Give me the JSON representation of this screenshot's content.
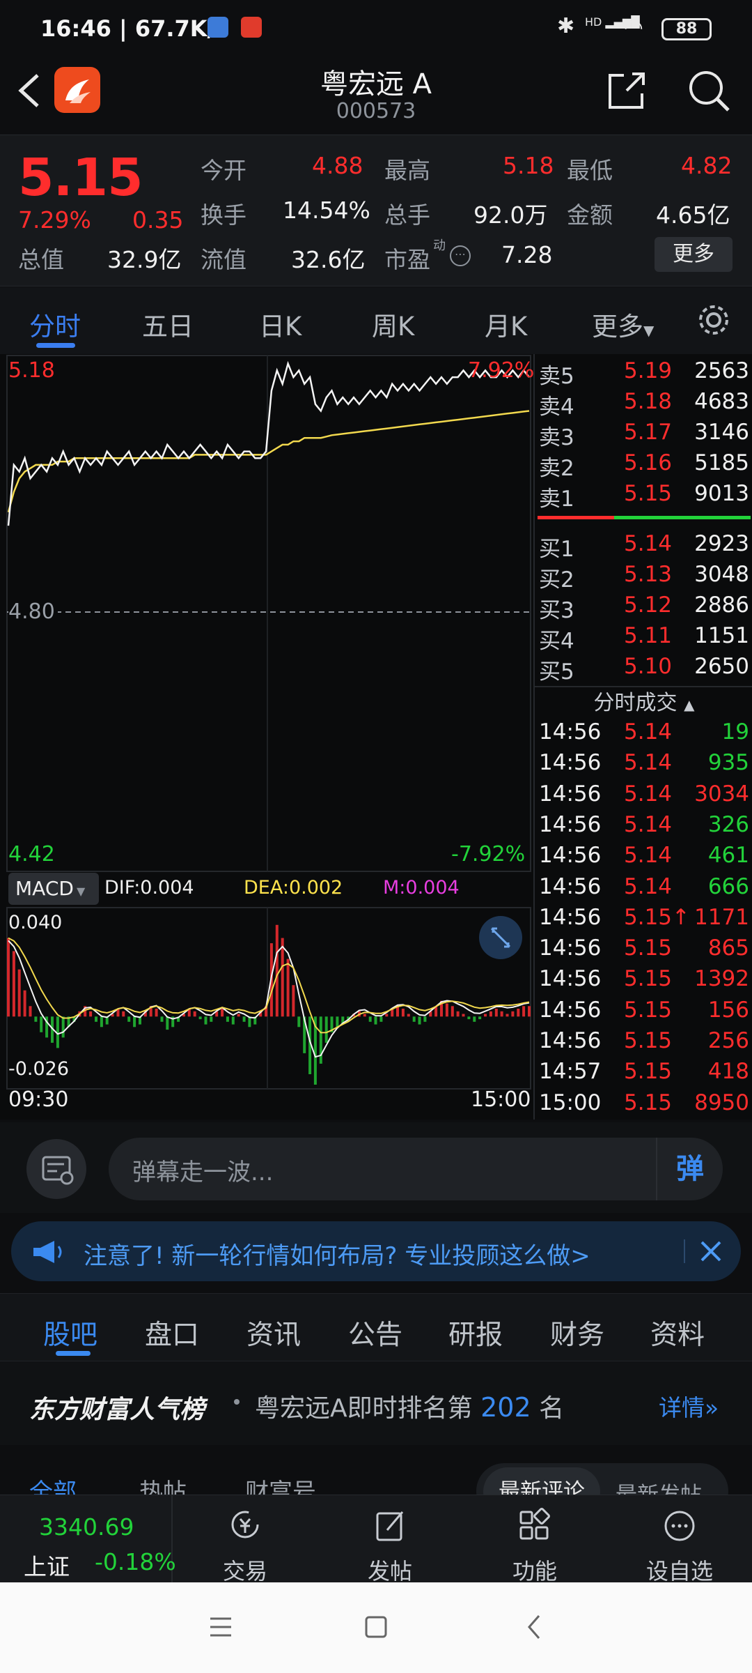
{
  "status_bar": {
    "time_speed": "16:46 | 67.7K/s",
    "network": "HD",
    "battery": "88"
  },
  "header": {
    "name": "粤宏远 A",
    "code": "000573"
  },
  "quote": {
    "price": "5.15",
    "change_pct": "7.29%",
    "change": "0.35",
    "stats": [
      {
        "label": "今开",
        "value": "4.88",
        "color": "red"
      },
      {
        "label": "最高",
        "value": "5.18",
        "color": "red"
      },
      {
        "label": "最低",
        "value": "4.82",
        "color": "red"
      },
      {
        "label": "换手",
        "value": "14.54%",
        "color": "white"
      },
      {
        "label": "总手",
        "value": "92.0万",
        "color": "white"
      },
      {
        "label": "金额",
        "value": "4.65亿",
        "color": "white"
      },
      {
        "label": "总值",
        "value": "32.9亿",
        "color": "white"
      },
      {
        "label": "流值",
        "value": "32.6亿",
        "color": "white"
      },
      {
        "label": "市盈",
        "value": "7.28",
        "color": "white"
      }
    ],
    "pe_sup": "动",
    "more_button": "更多"
  },
  "chart_tabs": [
    "分时",
    "五日",
    "日K",
    "周K",
    "月K",
    "更多"
  ],
  "chart_tabs_active": 0,
  "chart_data": {
    "type": "line",
    "price_axis": {
      "top": "5.18",
      "mid": "4.80",
      "bottom": "4.42",
      "top_pct": "7.92%",
      "bottom_pct": "-7.92%",
      "ylim": [
        4.42,
        5.18
      ]
    },
    "time_axis": {
      "start": "09:30",
      "end": "15:00"
    },
    "macd": {
      "label": "MACD",
      "dif": "DIF:0.004",
      "dea": "DEA:0.002",
      "m": "M:0.004",
      "top": "0.040",
      "bottom": "-0.026"
    },
    "price_series": [
      4.93,
      5.02,
      5.01,
      5.03,
      5.0,
      5.01,
      5.02,
      5.01,
      5.03,
      5.02,
      5.04,
      5.02,
      5.03,
      5.01,
      5.03,
      5.02,
      5.03,
      5.02,
      5.04,
      5.03,
      5.02,
      5.03,
      5.04,
      5.02,
      5.03,
      5.04,
      5.03,
      5.04,
      5.03,
      5.05,
      5.04,
      5.03,
      5.04,
      5.03,
      5.04,
      5.05,
      5.04,
      5.03,
      5.04,
      5.03,
      5.05,
      5.04,
      5.03,
      5.04,
      5.04,
      5.03,
      5.03,
      5.04,
      5.13,
      5.16,
      5.14,
      5.17,
      5.15,
      5.16,
      5.14,
      5.15,
      5.11,
      5.1,
      5.12,
      5.13,
      5.11,
      5.12,
      5.11,
      5.12,
      5.11,
      5.12,
      5.13,
      5.12,
      5.13,
      5.12,
      5.14,
      5.13,
      5.14,
      5.13,
      5.14,
      5.13,
      5.14,
      5.15,
      5.14,
      5.15,
      5.14,
      5.15,
      5.15,
      5.16,
      5.15,
      5.16,
      5.15,
      5.16,
      5.15,
      5.15,
      5.16,
      5.15,
      5.16,
      5.15,
      5.16,
      5.15
    ],
    "avg_series": [
      4.95,
      4.98,
      5.0,
      5.01,
      5.015,
      5.02,
      5.02,
      5.02,
      5.02,
      5.025,
      5.025,
      5.025,
      5.03,
      5.03,
      5.03,
      5.03,
      5.03,
      5.03,
      5.03,
      5.03,
      5.03,
      5.03,
      5.03,
      5.03,
      5.03,
      5.03,
      5.03,
      5.03,
      5.03,
      5.03,
      5.03,
      5.03,
      5.03,
      5.03,
      5.035,
      5.035,
      5.035,
      5.035,
      5.035,
      5.035,
      5.035,
      5.035,
      5.035,
      5.035,
      5.035,
      5.035,
      5.035,
      5.035,
      5.04,
      5.045,
      5.05,
      5.05,
      5.055,
      5.055,
      5.06,
      5.06,
      5.06,
      5.06,
      5.062,
      5.064,
      5.065,
      5.066,
      5.067,
      5.068,
      5.069,
      5.07,
      5.071,
      5.072,
      5.073,
      5.074,
      5.075,
      5.076,
      5.077,
      5.078,
      5.079,
      5.08,
      5.081,
      5.082,
      5.083,
      5.084,
      5.085,
      5.086,
      5.087,
      5.088,
      5.089,
      5.09,
      5.091,
      5.092,
      5.093,
      5.094,
      5.095,
      5.096,
      5.097,
      5.098,
      5.099,
      5.1
    ],
    "macd_bars": [
      0.03,
      0.025,
      0.018,
      0.01,
      0.004,
      -0.002,
      -0.006,
      -0.008,
      -0.01,
      -0.012,
      -0.008,
      -0.004,
      -0.002,
      0.002,
      0.004,
      0.002,
      -0.002,
      -0.004,
      -0.003,
      0.001,
      0.003,
      0.002,
      -0.002,
      -0.004,
      -0.003,
      0.002,
      0.004,
      0.003,
      -0.002,
      -0.005,
      -0.004,
      -0.002,
      0.001,
      0.003,
      0.002,
      -0.001,
      -0.003,
      -0.002,
      0.002,
      0.003,
      -0.002,
      -0.003,
      0.001,
      -0.002,
      -0.004,
      -0.003,
      0.002,
      0.004,
      0.028,
      0.035,
      0.03,
      0.022,
      0.012,
      -0.004,
      -0.014,
      -0.022,
      -0.026,
      -0.018,
      -0.01,
      -0.006,
      -0.004,
      -0.003,
      -0.002,
      0.001,
      0.002,
      0.001,
      -0.002,
      -0.003,
      -0.002,
      0.001,
      0.003,
      0.004,
      0.003,
      0.001,
      -0.002,
      -0.003,
      -0.002,
      0.002,
      0.004,
      0.006,
      0.005,
      0.004,
      0.002,
      0.001,
      -0.001,
      -0.002,
      -0.001,
      0.001,
      0.002,
      0.003,
      0.002,
      0.001,
      0.002,
      0.003,
      0.004,
      0.004
    ]
  },
  "order_book": {
    "sell": [
      {
        "label": "卖5",
        "price": "5.19",
        "vol": "2563"
      },
      {
        "label": "卖4",
        "price": "5.18",
        "vol": "4683"
      },
      {
        "label": "卖3",
        "price": "5.17",
        "vol": "3146"
      },
      {
        "label": "卖2",
        "price": "5.16",
        "vol": "5185"
      },
      {
        "label": "卖1",
        "price": "5.15",
        "vol": "9013"
      }
    ],
    "buy": [
      {
        "label": "买1",
        "price": "5.14",
        "vol": "2923"
      },
      {
        "label": "买2",
        "price": "5.13",
        "vol": "3048"
      },
      {
        "label": "买3",
        "price": "5.12",
        "vol": "2886"
      },
      {
        "label": "买4",
        "price": "5.11",
        "vol": "1151"
      },
      {
        "label": "买5",
        "price": "5.10",
        "vol": "2650"
      }
    ]
  },
  "ticks": {
    "header": "分时成交",
    "rows": [
      {
        "t": "14:56",
        "p": "5.14",
        "v": "19",
        "vc": "green"
      },
      {
        "t": "14:56",
        "p": "5.14",
        "v": "935",
        "vc": "green"
      },
      {
        "t": "14:56",
        "p": "5.14",
        "v": "3034",
        "vc": "red"
      },
      {
        "t": "14:56",
        "p": "5.14",
        "v": "326",
        "vc": "green"
      },
      {
        "t": "14:56",
        "p": "5.14",
        "v": "461",
        "vc": "green"
      },
      {
        "t": "14:56",
        "p": "5.14",
        "v": "666",
        "vc": "green"
      },
      {
        "t": "14:56",
        "p": "5.15↑",
        "v": "1171",
        "vc": "red"
      },
      {
        "t": "14:56",
        "p": "5.15",
        "v": "865",
        "vc": "red"
      },
      {
        "t": "14:56",
        "p": "5.15",
        "v": "1392",
        "vc": "red"
      },
      {
        "t": "14:56",
        "p": "5.15",
        "v": "156",
        "vc": "red"
      },
      {
        "t": "14:56",
        "p": "5.15",
        "v": "256",
        "vc": "red"
      },
      {
        "t": "14:57",
        "p": "5.15",
        "v": "418",
        "vc": "red"
      },
      {
        "t": "15:00",
        "p": "5.15",
        "v": "8950",
        "vc": "red"
      }
    ]
  },
  "danmu": {
    "placeholder": "弹幕走一波...",
    "button": "弹"
  },
  "notice": {
    "text": "注意了! 新一轮行情如何布局? 专业投顾这么做>"
  },
  "section_tabs": [
    "股吧",
    "盘口",
    "资讯",
    "公告",
    "研报",
    "财务",
    "资料"
  ],
  "section_tabs_active": 0,
  "rank": {
    "brand": "东方财富人气榜",
    "text": "粤宏远A即时排名第",
    "rank_num": "202",
    "suffix": "名",
    "detail": "详情"
  },
  "sub_tabs": {
    "left": [
      "全部",
      "热帖",
      "财富号"
    ],
    "right": [
      "最新评论",
      "最新发帖"
    ]
  },
  "bottom_nav": {
    "index_value": "3340.69",
    "index_name": "上证",
    "index_change": "-0.18%",
    "items": [
      "交易",
      "发帖",
      "功能",
      "设自选"
    ]
  }
}
